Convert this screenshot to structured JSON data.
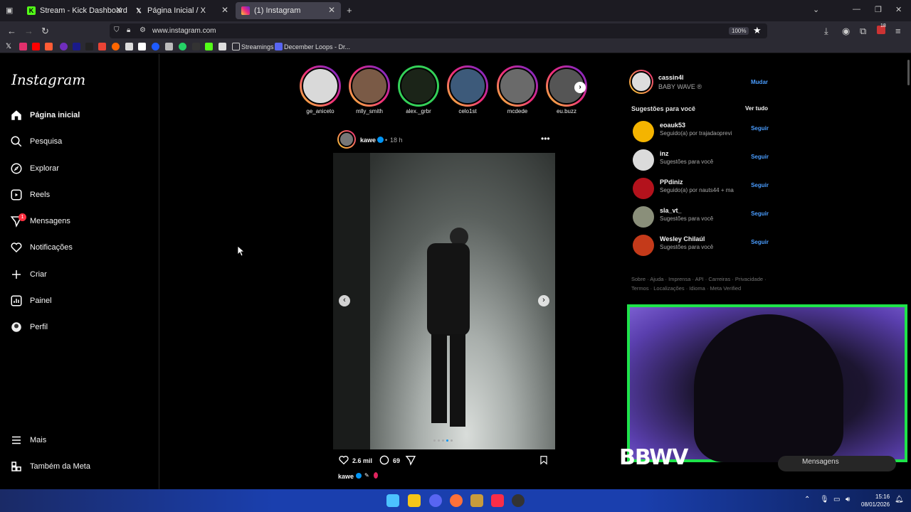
{
  "browser": {
    "tabs": [
      {
        "title": "Stream - Kick Dashboard",
        "icon": "kick-icon",
        "color": "#53fc18"
      },
      {
        "title": "Página Inicial / X",
        "icon": "x-icon",
        "color": "#ffffff"
      },
      {
        "title": "(1) Instagram",
        "icon": "instagram-icon",
        "color": "#e1306c"
      }
    ],
    "url": "www.instagram.com",
    "zoom": "100%",
    "downloads_badge": "18",
    "bookmarks": [
      {
        "label": "Streamings"
      },
      {
        "label": "December Loops - Dr..."
      }
    ]
  },
  "sidebar": {
    "logo": "Instagram",
    "items": [
      {
        "label": "Página inicial",
        "icon": "home-icon"
      },
      {
        "label": "Pesquisa",
        "icon": "search-icon"
      },
      {
        "label": "Explorar",
        "icon": "compass-icon"
      },
      {
        "label": "Reels",
        "icon": "reels-icon"
      },
      {
        "label": "Mensagens",
        "icon": "messenger-icon",
        "badge": "1"
      },
      {
        "label": "Notificações",
        "icon": "heart-icon"
      },
      {
        "label": "Criar",
        "icon": "plus-icon"
      },
      {
        "label": "Painel",
        "icon": "dashboard-icon"
      },
      {
        "label": "Perfil",
        "icon": "profile-icon"
      }
    ],
    "bottom": [
      {
        "label": "Mais",
        "icon": "menu-icon"
      },
      {
        "label": "Também da Meta",
        "icon": "meta-icon"
      }
    ]
  },
  "stories": [
    {
      "name": "ge_aniceto",
      "color": "#d9d9d9"
    },
    {
      "name": "mlly_smith",
      "color": "#7a5a46"
    },
    {
      "name": "alex._grbr",
      "color": "#1b2418"
    },
    {
      "name": "celo1st",
      "color": "#3d5a7a"
    },
    {
      "name": "mcdede",
      "color": "#6a6a6a"
    },
    {
      "name": "eu.buzz",
      "color": "#555555"
    }
  ],
  "post": {
    "author": "kawe",
    "time": "18 h",
    "likes": "2.6 mil",
    "comments": "69",
    "caption_author": "kawe"
  },
  "profile": {
    "username": "cassin4l",
    "subtitle": "BABY WAVE ®",
    "switch": "Mudar"
  },
  "suggestions": {
    "title": "Sugestões para você",
    "see_all": "Ver tudo",
    "follow": "Seguir",
    "items": [
      {
        "name": "eoauk53",
        "sub": "Seguido(a) por trajadaoprevi",
        "color": "#f4b400"
      },
      {
        "name": "inz",
        "sub": "Sugestões para você",
        "color": "#dbdbdb"
      },
      {
        "name": "PPdiniz",
        "sub": "Seguido(a) por nauts44 + ma",
        "color": "#b3121c"
      },
      {
        "name": "sla_vt_",
        "sub": "Sugestões para você",
        "color": "#8a8f7a"
      },
      {
        "name": "Wesley Chilaúl",
        "sub": "Sugestões para você",
        "color": "#c43a1a"
      }
    ]
  },
  "footer": {
    "line1": "Sobre · Ajuda · Imprensa · API · Carreiras · Privacidade ·",
    "line2": "Termos · Localizações · Idioma · Meta Verified"
  },
  "overlay": {
    "brand": "BBWV",
    "messages": "Mensagens"
  },
  "taskbar": {
    "time": "15:16",
    "date": "08/01/2026"
  }
}
